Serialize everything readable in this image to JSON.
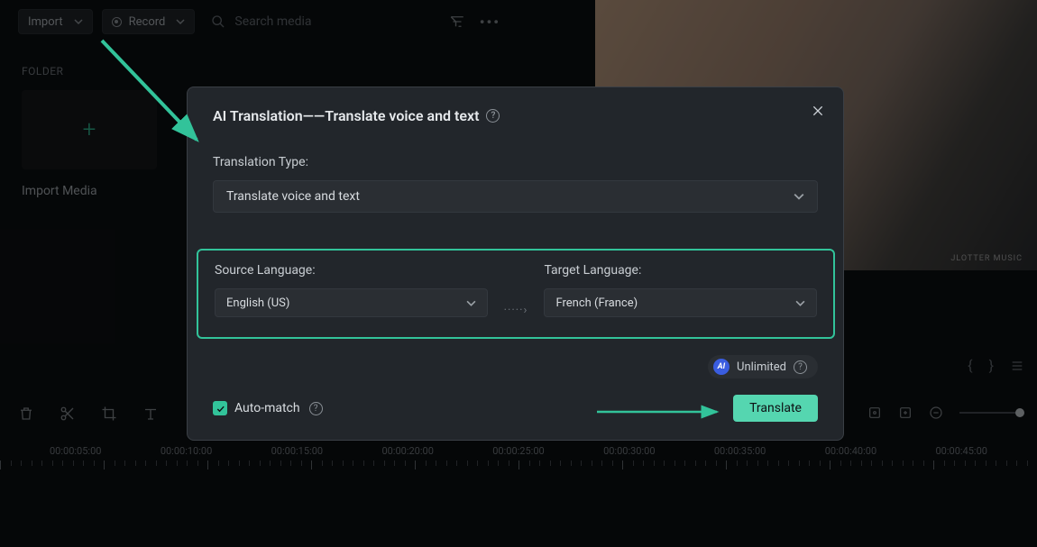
{
  "topbar": {
    "import_label": "Import",
    "record_label": "Record",
    "search_placeholder": "Search media"
  },
  "media_panel": {
    "folder_heading": "FOLDER",
    "import_tile_label": "Import Media"
  },
  "preview": {
    "watermark": "JLOTTER MUSIC"
  },
  "modal": {
    "title": "AI Translation——Translate voice and text",
    "translation_type_label": "Translation Type:",
    "translation_type_value": "Translate voice and text",
    "source_label": "Source Language:",
    "source_value": "English (US)",
    "target_label": "Target Language:",
    "target_value": "French (France)",
    "unlimited_label": "Unlimited",
    "auto_match_label": "Auto-match",
    "translate_button": "Translate"
  },
  "timeline": {
    "labels": [
      "00:00:05:00",
      "00:00:10:00",
      "00:00:15:00",
      "00:00:20:00",
      "00:00:25:00",
      "00:00:30:00",
      "00:00:35:00",
      "00:00:40:00",
      "00:00:45:00"
    ]
  }
}
